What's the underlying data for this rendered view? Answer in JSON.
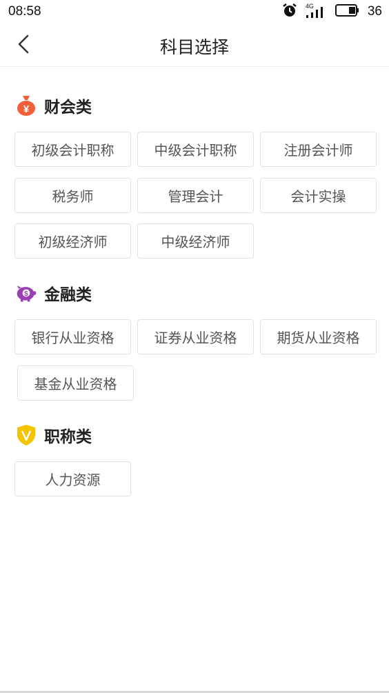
{
  "status_bar": {
    "time": "08:58",
    "network": "4G",
    "battery": "36"
  },
  "header": {
    "title": "科目选择"
  },
  "sections": [
    {
      "title": "财会类",
      "icon": "money-bag-icon",
      "icon_color": "#f2603a",
      "items": [
        "初级会计职称",
        "中级会计职称",
        "注册会计师",
        "税务师",
        "管理会计",
        "会计实操",
        "初级经济师",
        "中级经济师"
      ]
    },
    {
      "title": "金融类",
      "icon": "piggy-bank-icon",
      "icon_color": "#9b3fb5",
      "items": [
        "银行从业资格",
        "证券从业资格",
        "期货从业资格",
        "基金从业资格"
      ]
    },
    {
      "title": "职称类",
      "icon": "shield-v-icon",
      "icon_color": "#f5c400",
      "items": [
        "人力资源"
      ]
    }
  ]
}
